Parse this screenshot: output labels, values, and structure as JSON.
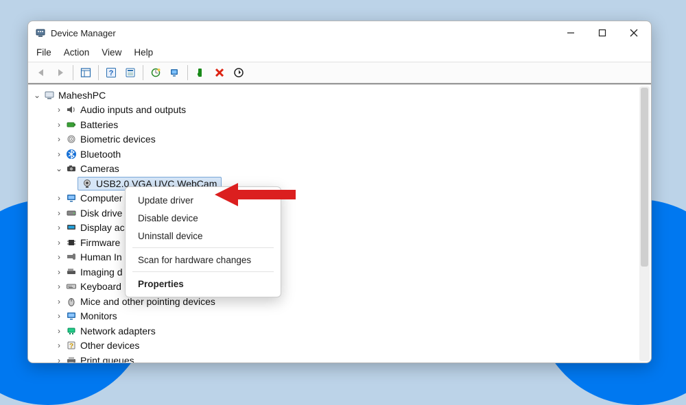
{
  "window": {
    "title": "Device Manager"
  },
  "menu": {
    "file": "File",
    "action": "Action",
    "view": "View",
    "help": "Help"
  },
  "root": {
    "name": "MaheshPC"
  },
  "categories": [
    {
      "icon": "audio",
      "label": "Audio inputs and outputs"
    },
    {
      "icon": "battery",
      "label": "Batteries"
    },
    {
      "icon": "biometric",
      "label": "Biometric devices"
    },
    {
      "icon": "bluetooth",
      "label": "Bluetooth"
    },
    {
      "icon": "camera",
      "label": "Cameras",
      "expanded": true,
      "children": [
        {
          "icon": "webcam",
          "label": "USB2.0 VGA UVC WebCam",
          "selected": true
        }
      ]
    },
    {
      "icon": "computer",
      "label": "Computer"
    },
    {
      "icon": "disk",
      "label": "Disk drives"
    },
    {
      "icon": "display",
      "label": "Display adapters"
    },
    {
      "icon": "firmware",
      "label": "Firmware"
    },
    {
      "icon": "hid",
      "label": "Human Interface Devices"
    },
    {
      "icon": "imaging",
      "label": "Imaging devices"
    },
    {
      "icon": "keyboard",
      "label": "Keyboards"
    },
    {
      "icon": "mouse",
      "label": "Mice and other pointing devices"
    },
    {
      "icon": "monitor",
      "label": "Monitors"
    },
    {
      "icon": "network",
      "label": "Network adapters"
    },
    {
      "icon": "other",
      "label": "Other devices"
    },
    {
      "icon": "printer",
      "label": "Print queues"
    }
  ],
  "truncated": {
    "computer": "Computer",
    "disk": "Disk drive",
    "display": "Display ac",
    "firmware": "Firmware",
    "hid": "Human In",
    "imaging": "Imaging d",
    "keyboard": "Keyboard"
  },
  "context_menu": {
    "update": "Update driver",
    "disable": "Disable device",
    "uninstall": "Uninstall device",
    "scan": "Scan for hardware changes",
    "properties": "Properties"
  },
  "colors": {
    "selection": "#d6e6f7",
    "arrow": "#db1f1f"
  }
}
